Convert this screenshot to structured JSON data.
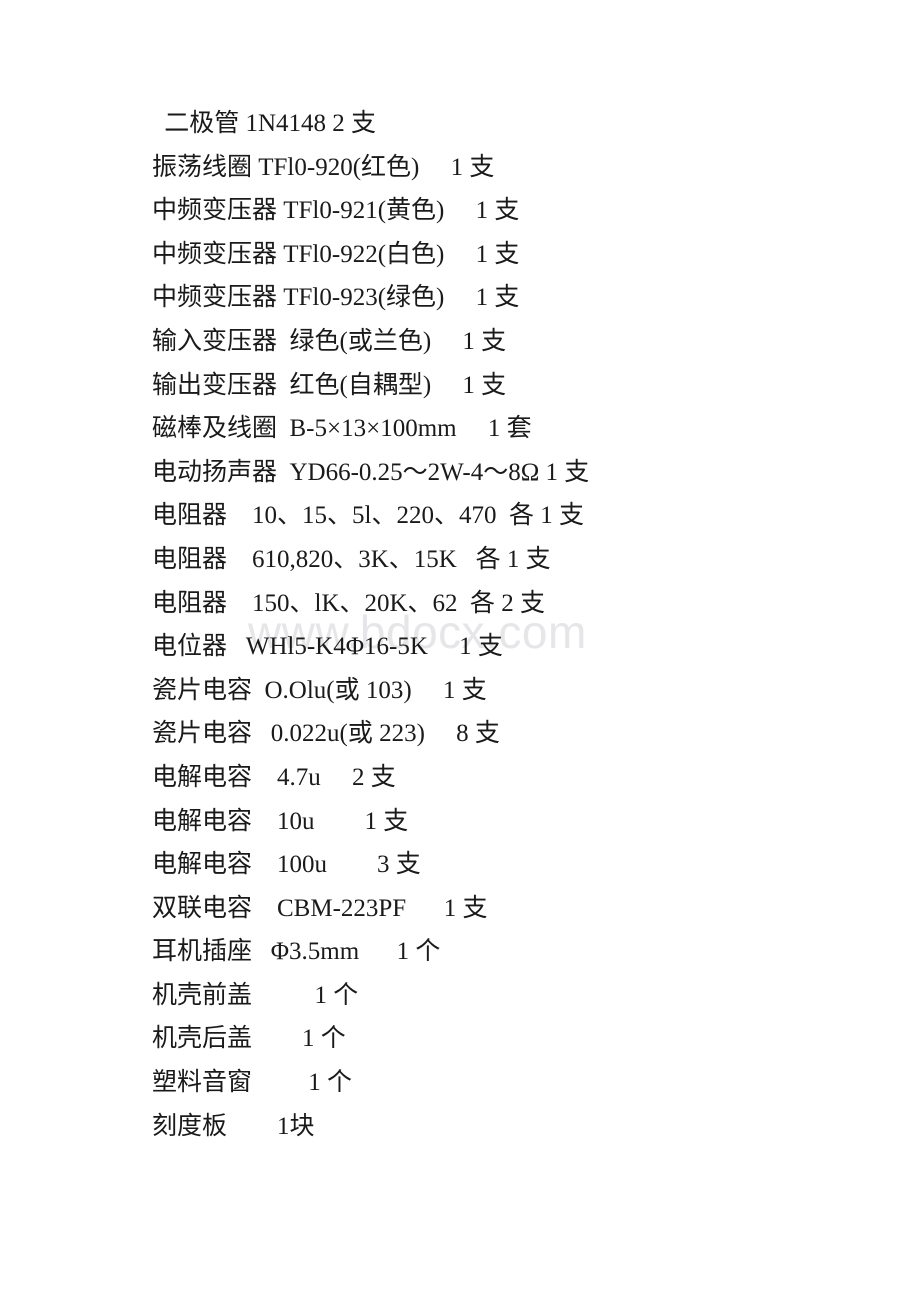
{
  "document": {
    "background_color": "#ffffff",
    "text_color": "#1a1a1a",
    "watermark": {
      "text": "www.bdocx.com",
      "color": "#e6e6e9"
    },
    "lines": [
      {
        "text": " 二极管 1N4148 2 支"
      },
      {
        "text": "振荡线圈 TFl0-920(红色)     1 支"
      },
      {
        "text": "中频变压器 TFl0-921(黄色)     1 支"
      },
      {
        "text": "中频变压器 TFl0-922(白色)     1 支"
      },
      {
        "text": "中频变压器 TFl0-923(绿色)     1 支"
      },
      {
        "text": "输入变压器  绿色(或兰色)     1 支"
      },
      {
        "text": "输出变压器  红色(自耦型)     1 支"
      },
      {
        "text": "磁棒及线圈  B-5×13×100mm     1 套"
      },
      {
        "text": "电动扬声器  YD66-0.25～2W-4～8Ω 1 支"
      },
      {
        "text": "电阻器    10、15、5l、220、470  各 1 支"
      },
      {
        "text": "电阻器    610,820、3K、15K   各 1 支"
      },
      {
        "text": "电阻器    150、lK、20K、62  各 2 支"
      },
      {
        "text": "电位器   WHl5-K4Φ16-5K     1 支"
      },
      {
        "text": "瓷片电容  O.Olu(或 103)     1 支"
      },
      {
        "text": "瓷片电容   0.022u(或 223)     8 支"
      },
      {
        "text": "电解电容    4.7u     2 支"
      },
      {
        "text": "电解电容    10u        1 支"
      },
      {
        "text": "电解电容    100u        3 支"
      },
      {
        "text": "双联电容    CBM-223PF      1 支"
      },
      {
        "text": "耳机插座   Φ3.5mm      1 个"
      },
      {
        "text": "机壳前盖          1 个"
      },
      {
        "text": "机壳后盖        1 个"
      },
      {
        "text": "塑料音窗         1 个"
      },
      {
        "text": "刻度板        1块"
      }
    ]
  }
}
